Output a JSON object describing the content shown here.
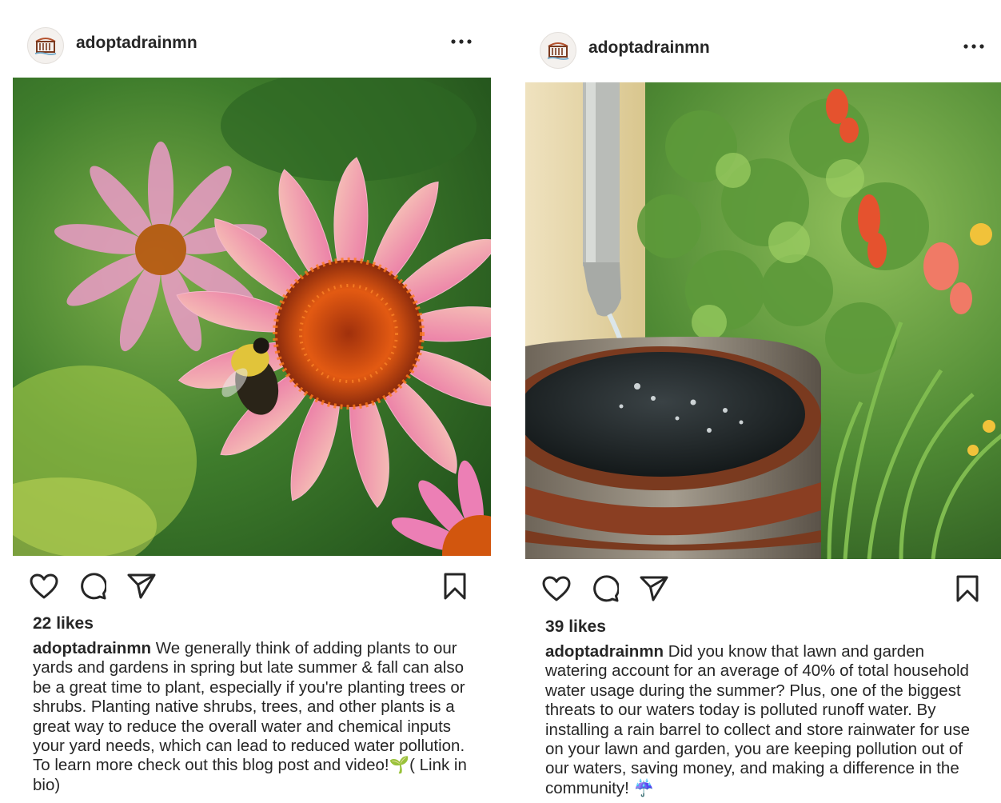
{
  "posts": [
    {
      "username": "adoptadrainmn",
      "likes": "22 likes",
      "caption_user": "adoptadrainmn",
      "caption_text": "We generally think of adding plants to our yards and gardens in spring but late summer & fall can also be a great time to plant, especially if you're planting trees or shrubs. Planting native shrubs, trees, and other plants is a great way to reduce the overall water and chemical inputs your yard needs, which can lead to reduced water pollution. To learn more check out this blog post and video!🌱( Link in bio)"
    },
    {
      "username": "adoptadrainmn",
      "likes": "39 likes",
      "caption_user": "adoptadrainmn",
      "caption_text": "Did you know that lawn and garden watering account for an average of 40% of total household water usage during the summer? Plus, one of the biggest threats to our waters today is polluted runoff water. By installing a rain barrel to collect and store rainwater for use on your lawn and garden, you are keeping pollution out of our waters, saving money, and making a difference in the community! ☔"
    }
  ],
  "icons": {
    "avatar": "storm-drain-logo",
    "more": "more-options-icon",
    "like": "heart-icon",
    "comment": "comment-bubble-icon",
    "share": "paper-plane-icon",
    "save": "bookmark-icon"
  },
  "colors": {
    "text": "#262626",
    "background": "#ffffff",
    "logo_accent": "#b5532f"
  }
}
